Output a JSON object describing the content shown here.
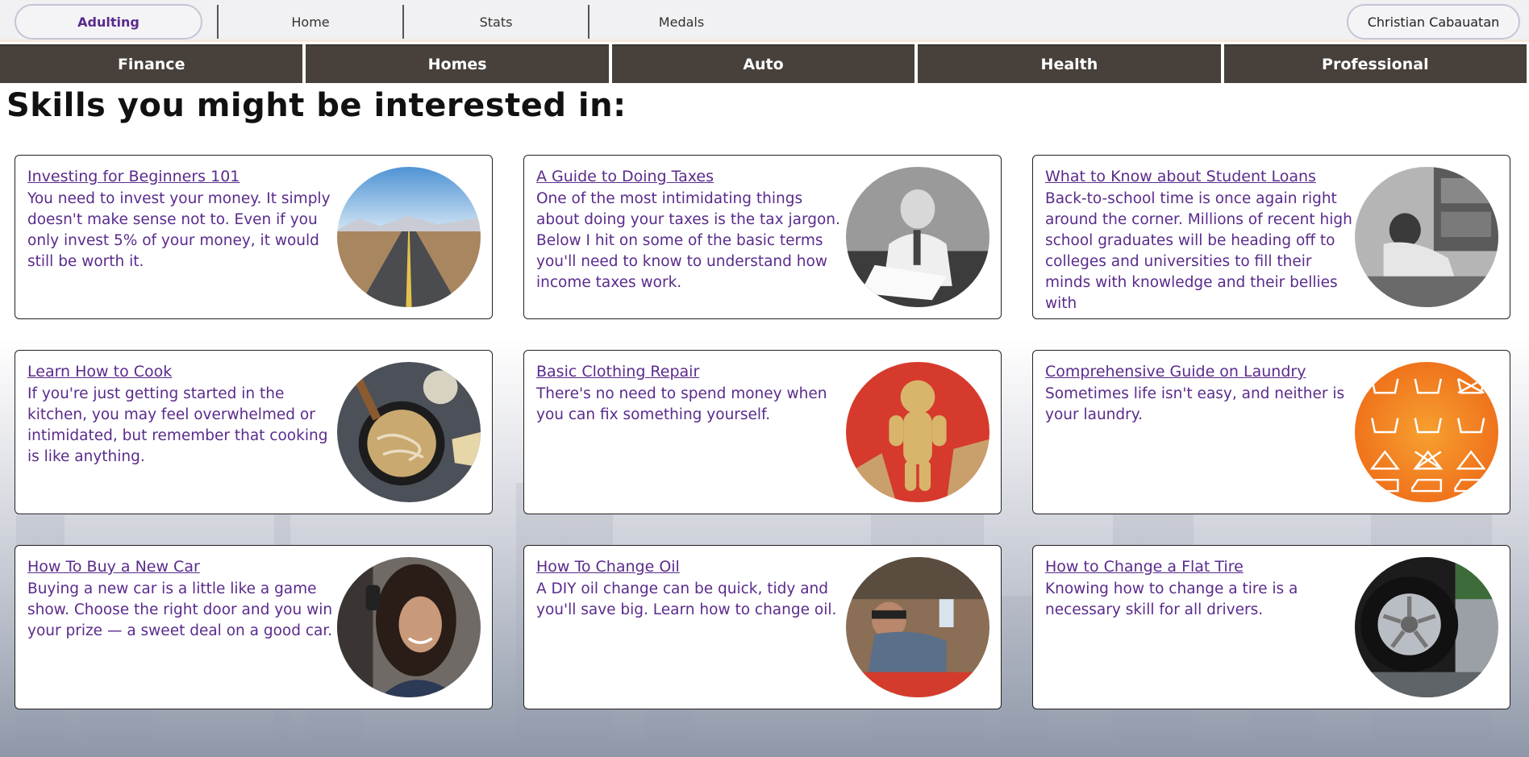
{
  "topbar": {
    "brand": "Adulting",
    "nav": [
      "Home",
      "Stats",
      "Medals"
    ],
    "user": "Christian Cabauatan"
  },
  "categories": [
    "Finance",
    "Homes",
    "Auto",
    "Health",
    "Professional"
  ],
  "heading": "Skills you might be interested in:",
  "cards": [
    {
      "title": "Investing for Beginners 101",
      "desc": "You need to invest your money. It simply doesn't make sense not to. Even if you only invest 5% of your money, it would still be worth it.",
      "icon": "road-image"
    },
    {
      "title": "A Guide to Doing Taxes",
      "desc": "One of the most intimidating things about doing your taxes is the tax jargon. Below I hit on some of the basic terms you'll need to know to understand how income taxes work.",
      "icon": "stressed-man-image"
    },
    {
      "title": "What to Know about Student Loans",
      "desc": "Back-to-school time is once again right around the corner. Millions of recent high school graduates will be heading off to colleges and universities to fill their minds with knowledge and their bellies with",
      "icon": "student-desk-image"
    },
    {
      "title": "Learn How to Cook",
      "desc": "If you're just getting started in the kitchen, you may feel overwhelmed or intimidated, but remember that cooking is like anything.",
      "icon": "pasta-pan-image"
    },
    {
      "title": "Basic Clothing Repair",
      "desc": "There's no need to spend money when you can fix something yourself.",
      "icon": "sewing-doll-image"
    },
    {
      "title": "Comprehensive Guide on Laundry",
      "desc": "Sometimes life isn't easy, and neither is your laundry.",
      "icon": "laundry-symbols-image"
    },
    {
      "title": "How To Buy a New Car",
      "desc": "Buying a new car is a little like a game show. Choose the right door and you win your prize — a sweet deal on a good car.",
      "icon": "woman-car-keys-image"
    },
    {
      "title": "How To Change Oil",
      "desc": "A DIY oil change can be quick, tidy and you'll save big. Learn how to change oil.",
      "icon": "mechanic-image"
    },
    {
      "title": "How to Change a Flat Tire",
      "desc": "Knowing how to change a tire is a necessary skill for all drivers.",
      "icon": "flat-tire-image"
    }
  ],
  "laundry_labels": [
    "Machine wash",
    "Hand wash",
    "Do not wash",
    "Wash cold",
    "Wash warm",
    "Wash hot",
    "Bleaching allowed",
    "Do not bleach",
    "Use non-chlorine bleach",
    "Iron medium",
    "Iron high"
  ],
  "colors": {
    "accent": "#5a2b8c",
    "catbar": "#47403b",
    "laundry": "#f07a1e"
  }
}
